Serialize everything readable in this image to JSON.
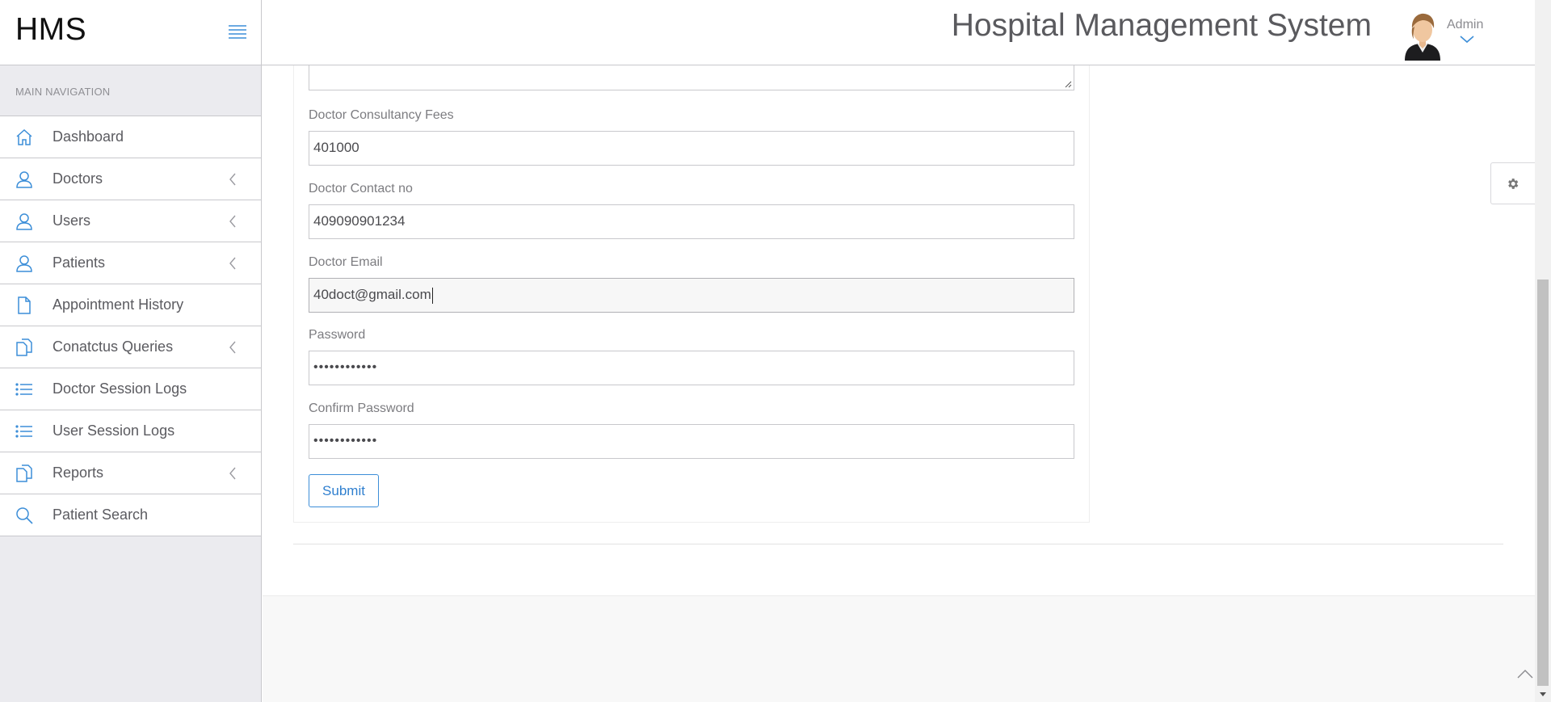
{
  "brand": {
    "text": "HMS"
  },
  "header": {
    "title": "Hospital Management System",
    "user_name": "Admin"
  },
  "sidebar": {
    "heading": "MAIN NAVIGATION",
    "items": [
      {
        "label": "Dashboard",
        "icon": "home-icon",
        "has_arrow": false
      },
      {
        "label": "Doctors",
        "icon": "user-icon",
        "has_arrow": true
      },
      {
        "label": "Users",
        "icon": "user-icon",
        "has_arrow": true
      },
      {
        "label": "Patients",
        "icon": "user-icon",
        "has_arrow": true
      },
      {
        "label": "Appointment History",
        "icon": "file-icon",
        "has_arrow": false
      },
      {
        "label": "Conatctus Queries",
        "icon": "files-icon",
        "has_arrow": true
      },
      {
        "label": "Doctor Session Logs",
        "icon": "list-icon",
        "has_arrow": false
      },
      {
        "label": "User Session Logs",
        "icon": "list-icon",
        "has_arrow": false
      },
      {
        "label": "Reports",
        "icon": "files-icon",
        "has_arrow": true
      },
      {
        "label": "Patient Search",
        "icon": "search-icon",
        "has_arrow": false
      }
    ]
  },
  "form": {
    "fees_label": "Doctor Consultancy Fees",
    "fees_value": "401000",
    "contact_label": "Doctor Contact no",
    "contact_value": "409090901234",
    "email_label": "Doctor Email",
    "email_value": "40doct@gmail.com",
    "password_label": "Password",
    "password_value": "••••••••••••",
    "confirm_label": "Confirm Password",
    "confirm_value": "••••••••••••",
    "submit_label": "Submit"
  },
  "colors": {
    "accent": "#2f7fcf",
    "sidebar_bg": "#ebebef",
    "border": "#c8c8cc"
  }
}
